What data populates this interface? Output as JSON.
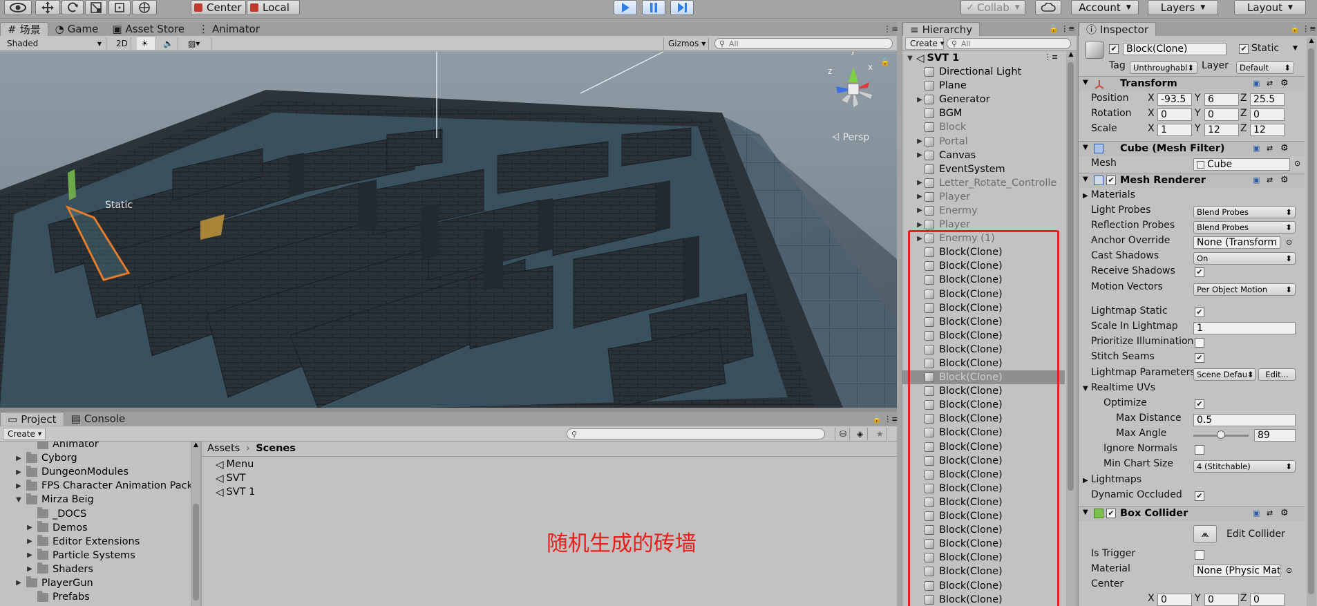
{
  "toolbar": {
    "pivot": "Center",
    "space": "Local",
    "collab": "Collab",
    "account": "Account",
    "layers": "Layers",
    "layout": "Layout",
    "tool_icons": [
      "eye-icon",
      "move-icon",
      "rotate-icon",
      "scale-icon",
      "rect-icon",
      "transform-icon"
    ],
    "play_icons": [
      "play-icon",
      "pause-icon",
      "step-icon"
    ]
  },
  "scene": {
    "tabs": [
      "场景",
      "Game",
      "Asset Store",
      "Animator"
    ],
    "shading": "Shaded",
    "mode2d": "2D",
    "gizmos": "Gizmos",
    "search_placeholder": "All",
    "persp": "Persp",
    "label": "Static",
    "axis": {
      "x": "x",
      "y": "y",
      "z": "z"
    }
  },
  "hierarchy": {
    "tab": "Hierarchy",
    "create": "Create",
    "search_placeholder": "All",
    "root": "SVT 1",
    "items": [
      {
        "label": "Directional Light",
        "arrow": "",
        "grey": false
      },
      {
        "label": "Plane",
        "arrow": "",
        "grey": false
      },
      {
        "label": "Generator",
        "arrow": "▶",
        "grey": false
      },
      {
        "label": "BGM",
        "arrow": "",
        "grey": false
      },
      {
        "label": "Block",
        "arrow": "",
        "grey": true
      },
      {
        "label": "Portal",
        "arrow": "▶",
        "grey": true
      },
      {
        "label": "Canvas",
        "arrow": "▶",
        "grey": false
      },
      {
        "label": "EventSystem",
        "arrow": "",
        "grey": false
      },
      {
        "label": "Letter_Rotate_Controlle",
        "arrow": "▶",
        "grey": true
      },
      {
        "label": "Player",
        "arrow": "▶",
        "grey": true
      },
      {
        "label": "Enermy",
        "arrow": "▶",
        "grey": true
      },
      {
        "label": "Player",
        "arrow": "▶",
        "grey": true
      },
      {
        "label": "Enermy (1)",
        "arrow": "▶",
        "grey": true
      },
      {
        "label": "Block(Clone)",
        "arrow": "",
        "grey": false
      },
      {
        "label": "Block(Clone)",
        "arrow": "",
        "grey": false
      },
      {
        "label": "Block(Clone)",
        "arrow": "",
        "grey": false
      },
      {
        "label": "Block(Clone)",
        "arrow": "",
        "grey": false
      },
      {
        "label": "Block(Clone)",
        "arrow": "",
        "grey": false
      },
      {
        "label": "Block(Clone)",
        "arrow": "",
        "grey": false
      },
      {
        "label": "Block(Clone)",
        "arrow": "",
        "grey": false
      },
      {
        "label": "Block(Clone)",
        "arrow": "",
        "grey": false
      },
      {
        "label": "Block(Clone)",
        "arrow": "",
        "grey": false
      },
      {
        "label": "Block(Clone)",
        "arrow": "",
        "grey": false,
        "selected": true
      },
      {
        "label": "Block(Clone)",
        "arrow": "",
        "grey": false
      },
      {
        "label": "Block(Clone)",
        "arrow": "",
        "grey": false
      },
      {
        "label": "Block(Clone)",
        "arrow": "",
        "grey": false
      },
      {
        "label": "Block(Clone)",
        "arrow": "",
        "grey": false
      },
      {
        "label": "Block(Clone)",
        "arrow": "",
        "grey": false
      },
      {
        "label": "Block(Clone)",
        "arrow": "",
        "grey": false
      },
      {
        "label": "Block(Clone)",
        "arrow": "",
        "grey": false
      },
      {
        "label": "Block(Clone)",
        "arrow": "",
        "grey": false
      },
      {
        "label": "Block(Clone)",
        "arrow": "",
        "grey": false
      },
      {
        "label": "Block(Clone)",
        "arrow": "",
        "grey": false
      },
      {
        "label": "Block(Clone)",
        "arrow": "",
        "grey": false
      },
      {
        "label": "Block(Clone)",
        "arrow": "",
        "grey": false
      },
      {
        "label": "Block(Clone)",
        "arrow": "",
        "grey": false
      },
      {
        "label": "Block(Clone)",
        "arrow": "",
        "grey": false
      },
      {
        "label": "Block(Clone)",
        "arrow": "",
        "grey": false
      },
      {
        "label": "Block(Clone)",
        "arrow": "",
        "grey": false
      }
    ]
  },
  "inspector": {
    "tab": "Inspector",
    "name": "Block(Clone)",
    "static": "Static",
    "tag_label": "Tag",
    "tag": "Unthroughabl",
    "layer_label": "Layer",
    "layer": "Default",
    "transform": {
      "title": "Transform",
      "position": "Position",
      "rotation": "Rotation",
      "scale": "Scale",
      "pos": [
        "-93.5",
        "6",
        "25.5"
      ],
      "rot": [
        "0",
        "0",
        "0"
      ],
      "scl": [
        "1",
        "12",
        "12"
      ]
    },
    "mesh_filter": {
      "title": "Cube (Mesh Filter)",
      "mesh_label": "Mesh",
      "mesh": "Cube"
    },
    "mesh_renderer": {
      "title": "Mesh Renderer",
      "materials": "Materials",
      "light_probes": "Light Probes",
      "light_probes_val": "Blend Probes",
      "reflection_probes": "Reflection Probes",
      "reflection_probes_val": "Blend Probes",
      "anchor": "Anchor Override",
      "anchor_val": "None (Transform",
      "cast": "Cast Shadows",
      "cast_val": "On",
      "receive": "Receive Shadows",
      "motion": "Motion Vectors",
      "motion_val": "Per Object Motion",
      "lm_static": "Lightmap Static",
      "scale_lm": "Scale In Lightmap",
      "scale_lm_val": "1",
      "prioritize": "Prioritize Illumination",
      "stitch": "Stitch Seams",
      "lm_params": "Lightmap Parameters",
      "lm_params_val": "Scene Defau",
      "edit": "Edit...",
      "realtime": "Realtime UVs",
      "optimize": "Optimize",
      "max_dist": "Max Distance",
      "max_dist_val": "0.5",
      "max_angle": "Max Angle",
      "max_angle_val": "89",
      "max_angle_level": 0.5,
      "ignore_normals": "Ignore Normals",
      "min_chart": "Min Chart Size",
      "min_chart_val": "4 (Stitchable)",
      "lightmaps": "Lightmaps",
      "dyn_occ": "Dynamic Occluded"
    },
    "box_collider": {
      "title": "Box Collider",
      "edit": "Edit Collider",
      "trigger": "Is Trigger",
      "material": "Material",
      "material_val": "None (Physic Mat",
      "center": "Center",
      "center_vals": [
        "0",
        "0",
        "0"
      ]
    },
    "axis": [
      "X",
      "Y",
      "Z"
    ]
  },
  "project": {
    "tabs": [
      "Project",
      "Console"
    ],
    "create": "Create",
    "folders": [
      {
        "label": "Animator",
        "arrow": "",
        "indent": 1
      },
      {
        "label": "Cyborg",
        "arrow": "▶",
        "indent": 0
      },
      {
        "label": "DungeonModules",
        "arrow": "▶",
        "indent": 0
      },
      {
        "label": "FPS Character Animation Pack",
        "arrow": "▶",
        "indent": 0
      },
      {
        "label": "Mirza Beig",
        "arrow": "▼",
        "indent": 0
      },
      {
        "label": "_DOCS",
        "arrow": "",
        "indent": 1
      },
      {
        "label": "Demos",
        "arrow": "▶",
        "indent": 1
      },
      {
        "label": "Editor Extensions",
        "arrow": "▶",
        "indent": 1
      },
      {
        "label": "Particle Systems",
        "arrow": "▶",
        "indent": 1
      },
      {
        "label": "Shaders",
        "arrow": "▶",
        "indent": 1
      },
      {
        "label": "PlayerGun",
        "arrow": "▶",
        "indent": 0
      },
      {
        "label": "Prefabs",
        "arrow": "",
        "indent": 1
      }
    ],
    "breadcrumb": [
      "Assets",
      "Scenes"
    ],
    "files": [
      "Menu",
      "SVT",
      "SVT 1"
    ]
  },
  "annotation": "随机生成的砖墙",
  "colors": {
    "annotation": "#e8201a",
    "selection": "#ff7a1a",
    "play": "#2f7fe8"
  }
}
